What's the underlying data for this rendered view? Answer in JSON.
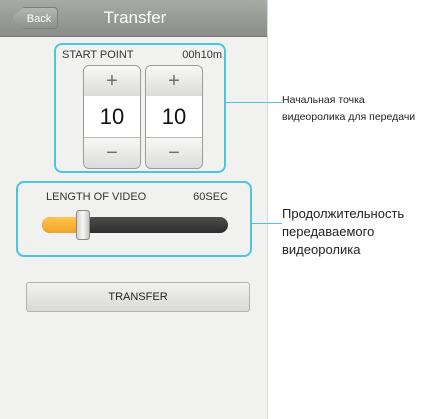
{
  "header": {
    "back_label": "Back",
    "title": "Transfer"
  },
  "start_point": {
    "label": "START POINT",
    "value": "00h10m",
    "hours_value": "10",
    "minutes_value": "10",
    "plus_symbol": "+",
    "minus_symbol": "−"
  },
  "length": {
    "label": "LENGTH OF VIDEO",
    "value": "60SEC",
    "slider_level": 0.22
  },
  "transfer_button": {
    "label": "TRANSFER"
  },
  "annotations": {
    "start_point_line1": "Начальная точка",
    "start_point_line2": "видеоролика для передачи",
    "length_line1": "Продолжительность",
    "length_line2": "передаваемого",
    "length_line3": "видеоролика"
  },
  "colors": {
    "highlight": "#4cc4e6",
    "slider_fill": "#f1a325",
    "slider_track": "#3a3a3a",
    "title_bar": "#999b98"
  },
  "icons": {
    "back": "back-arrow-icon",
    "increment": "plus-icon",
    "decrement": "minus-icon"
  }
}
